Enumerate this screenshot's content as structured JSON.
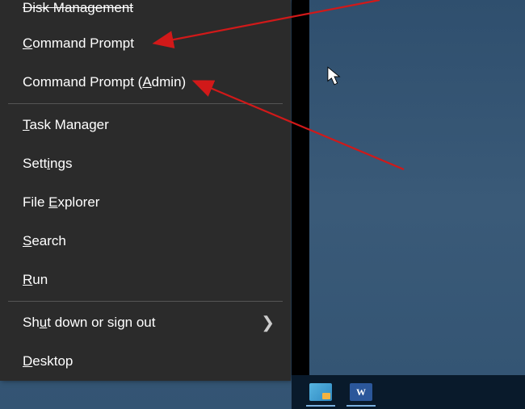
{
  "menu": {
    "disk_management": "Disk Management",
    "command_prompt_pre": "",
    "command_prompt_accel": "C",
    "command_prompt_post": "ommand Prompt",
    "command_prompt_admin_pre": "Command Prompt (",
    "command_prompt_admin_accel": "A",
    "command_prompt_admin_post": "dmin)",
    "task_manager_pre": "",
    "task_manager_accel": "T",
    "task_manager_post": "ask Manager",
    "settings_pre": "Sett",
    "settings_accel": "i",
    "settings_post": "ngs",
    "file_explorer_pre": "File ",
    "file_explorer_accel": "E",
    "file_explorer_post": "xplorer",
    "search_pre": "",
    "search_accel": "S",
    "search_post": "earch",
    "run_pre": "",
    "run_accel": "R",
    "run_post": "un",
    "shutdown_pre": "Sh",
    "shutdown_accel": "u",
    "shutdown_post": "t down or sign out",
    "desktop_pre": "",
    "desktop_accel": "D",
    "desktop_post": "esktop"
  },
  "icons": {
    "word_glyph": "W"
  }
}
